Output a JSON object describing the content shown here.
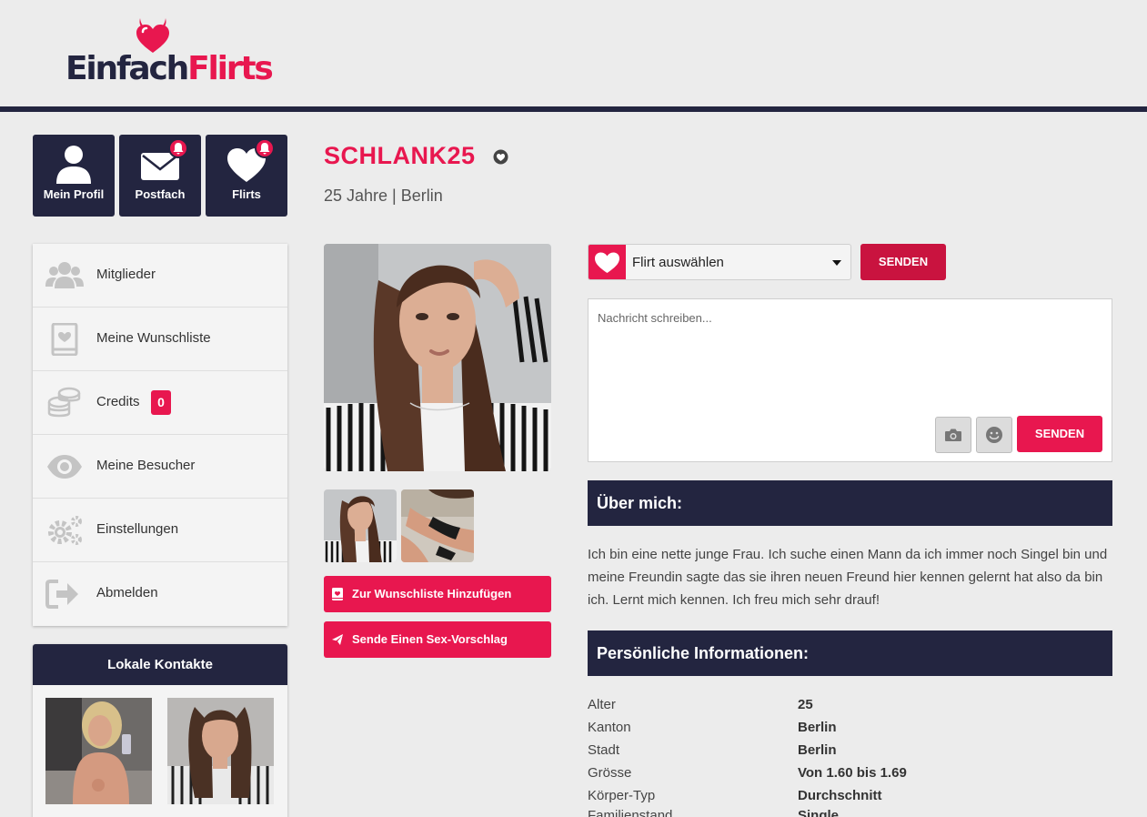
{
  "brand": {
    "part1": "Einfach",
    "part2": "Flirts"
  },
  "nav_tiles": [
    {
      "label": "Mein Profil",
      "icon": "user-icon"
    },
    {
      "label": "Postfach",
      "icon": "envelope-icon",
      "notification": true
    },
    {
      "label": "Flirts",
      "icon": "heart-icon",
      "notification": true
    }
  ],
  "sidebar": {
    "items": [
      {
        "label": "Mitglieder",
        "icon": "users-icon"
      },
      {
        "label": "Meine Wunschliste",
        "icon": "wishlist-book-icon"
      },
      {
        "label": "Credits",
        "icon": "coins-icon",
        "badge": "0"
      },
      {
        "label": "Meine Besucher",
        "icon": "eye-icon"
      },
      {
        "label": "Einstellungen",
        "icon": "gears-icon"
      },
      {
        "label": "Abmelden",
        "icon": "logout-icon"
      }
    ]
  },
  "contacts": {
    "title": "Lokale Kontakte"
  },
  "profile": {
    "name": "SCHLANK25",
    "subtitle": "25 Jahre | Berlin",
    "wishlist_button": "Zur Wunschliste Hinzufügen",
    "proposal_button": "Sende Einen Sex-Vorschlag"
  },
  "flirt": {
    "select_label": "Flirt auswählen",
    "send_label": "SENDEN"
  },
  "message": {
    "placeholder": "Nachricht schreiben...",
    "send_label": "SENDEN"
  },
  "about": {
    "title": "Über mich:",
    "text": "Ich bin eine nette junge Frau. Ich suche einen Mann da ich immer noch Singel bin und meine Freundin sagte das sie ihren neuen Freund hier kennen gelernt hat also da bin ich. Lernt mich kennen. Ich freu mich sehr drauf!"
  },
  "personal_info": {
    "title": "Persönliche Informationen:",
    "rows": [
      {
        "key": "Alter",
        "value": "25"
      },
      {
        "key": "Kanton",
        "value": "Berlin"
      },
      {
        "key": "Stadt",
        "value": "Berlin"
      },
      {
        "key": "Grösse",
        "value": "Von 1.60 bis 1.69"
      },
      {
        "key": "Körper-Typ",
        "value": "Durchschnitt"
      },
      {
        "key": "Familienstand",
        "value": "Single"
      }
    ]
  },
  "colors": {
    "accent": "#e8174f",
    "navy": "#232540",
    "background": "#ececec"
  }
}
